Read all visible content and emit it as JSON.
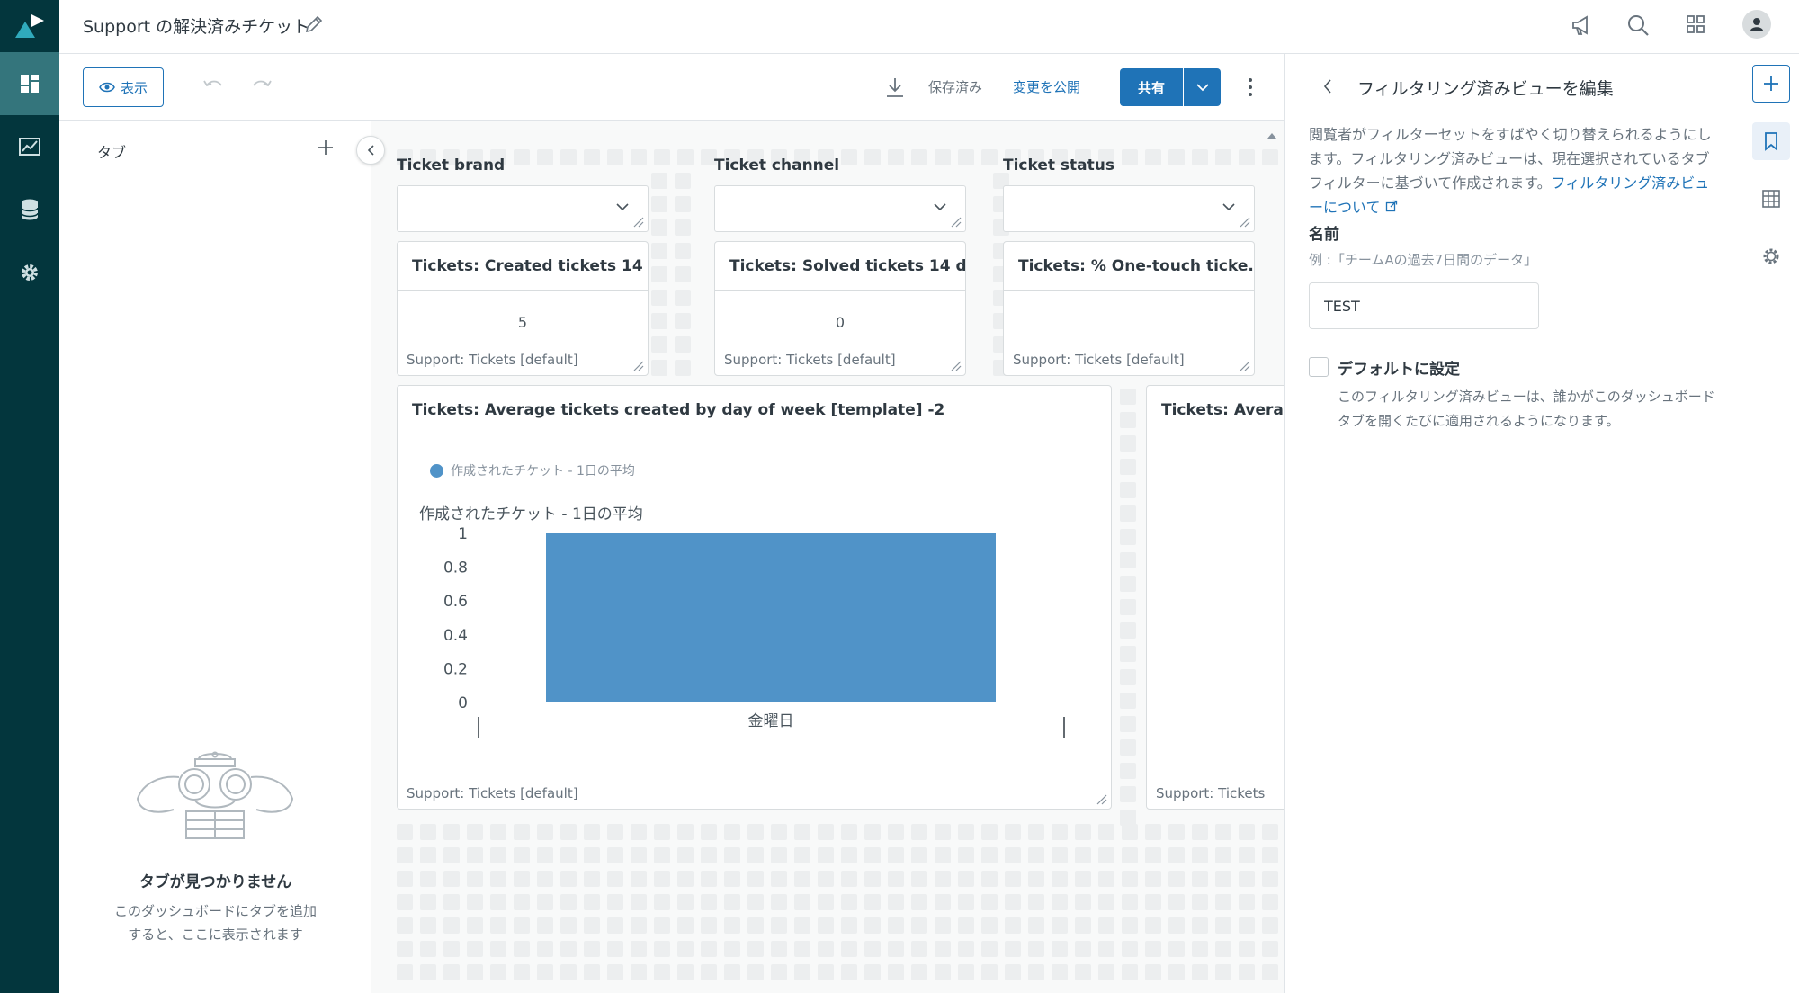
{
  "app": {
    "title": "Support の解決済みチケット"
  },
  "toolbar": {
    "view_label": "表示",
    "saved_label": "保存済み",
    "publish_label": "変更を公開",
    "share_label": "共有"
  },
  "tabs_panel": {
    "header": "タブ",
    "empty_title": "タブが見つかりません",
    "empty_desc": "このダッシュボードにタブを追加すると、ここに表示されます"
  },
  "filters": [
    {
      "label": "Ticket brand"
    },
    {
      "label": "Ticket channel"
    },
    {
      "label": "Ticket status"
    }
  ],
  "kpis": [
    {
      "title": "Tickets: Created tickets 14 ...",
      "value": "5",
      "source": "Support: Tickets [default]"
    },
    {
      "title": "Tickets: Solved tickets 14 d...",
      "value": "0",
      "source": "Support: Tickets [default]"
    },
    {
      "title": "Tickets: % One-touch ticke...",
      "value": "",
      "source": "Support: Tickets [default]"
    }
  ],
  "main_chart": {
    "title": "Tickets: Average tickets created by day of week [template] -2",
    "legend": "作成されたチケット - 1日の平均",
    "chart_title": "作成されたチケット - 1日の平均",
    "source": "Support: Tickets [default]",
    "bar_color": "#5093c8"
  },
  "chart_data": {
    "type": "bar",
    "title": "作成されたチケット - 1日の平均",
    "categories": [
      "金曜日"
    ],
    "series": [
      {
        "name": "作成されたチケット - 1日の平均",
        "values": [
          1
        ]
      }
    ],
    "yticks": [
      "1",
      "0.8",
      "0.6",
      "0.4",
      "0.2",
      "0"
    ],
    "ylim": [
      0,
      1
    ],
    "grid": false
  },
  "partial_card": {
    "title": "Tickets: Avera",
    "source": "Support: Tickets"
  },
  "right_panel": {
    "title": "フィルタリング済みビューを編集",
    "desc": "閲覧者がフィルターセットをすばやく切り替えられるようにします。フィルタリング済みビューは、現在選択されているタブフィルターに基づいて作成されます。",
    "link": "フィルタリング済みビューについて",
    "name_label": "名前",
    "name_hint": "例 :「チームAの過去7日間のデータ」",
    "name_value": "TEST",
    "default_label": "デフォルトに設定",
    "default_desc": "このフィルタリング済みビューは、誰かがこのダッシュボードタブを開くたびに適用されるようになります。"
  },
  "colors": {
    "nav_bg": "#03363d",
    "nav_active": "#34757c",
    "accent": "#1f73b7",
    "bar": "#5093c8"
  }
}
